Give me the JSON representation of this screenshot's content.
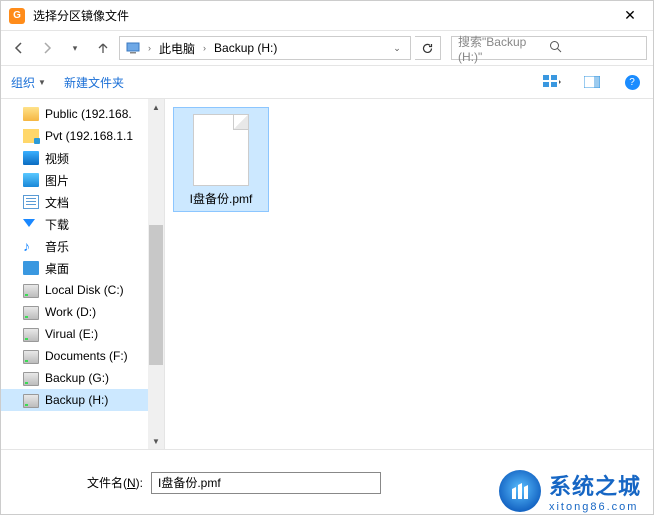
{
  "title": "选择分区镜像文件",
  "breadcrumb": {
    "root_icon": "›",
    "seg1": "此电脑",
    "seg2": "Backup (H:)"
  },
  "search": {
    "placeholder": "搜索\"Backup (H:)\""
  },
  "toolbar": {
    "organize": "组织",
    "newfolder": "新建文件夹"
  },
  "sidebar": {
    "items": [
      {
        "label": "Public (192.168.",
        "icon": "pub"
      },
      {
        "label": "Pvt (192.168.1.1",
        "icon": "net"
      },
      {
        "label": "视频",
        "icon": "video"
      },
      {
        "label": "图片",
        "icon": "pic"
      },
      {
        "label": "文档",
        "icon": "doc"
      },
      {
        "label": "下载",
        "icon": "dl"
      },
      {
        "label": "音乐",
        "icon": "music"
      },
      {
        "label": "桌面",
        "icon": "desk"
      },
      {
        "label": "Local Disk (C:)",
        "icon": "drive"
      },
      {
        "label": "Work (D:)",
        "icon": "drive"
      },
      {
        "label": "Virual (E:)",
        "icon": "drive"
      },
      {
        "label": "Documents (F:)",
        "icon": "drive"
      },
      {
        "label": "Backup (G:)",
        "icon": "drive"
      },
      {
        "label": "Backup (H:)",
        "icon": "drive",
        "selected": true
      }
    ]
  },
  "file": {
    "name": "I盘备份.pmf"
  },
  "footer": {
    "label_pre": "文件名(",
    "label_key": "N",
    "label_post": "):",
    "value": "I盘备份.pmf"
  },
  "watermark": {
    "title": "系统之城",
    "url": "xitong86.com"
  }
}
